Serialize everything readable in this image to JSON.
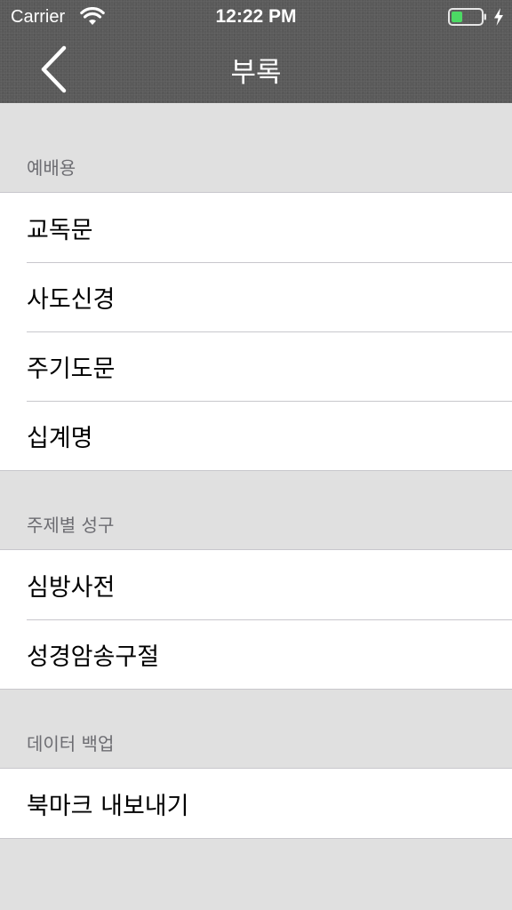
{
  "status_bar": {
    "carrier": "Carrier",
    "time": "12:22 PM",
    "battery_color": "#4cd964"
  },
  "nav": {
    "title": "부록",
    "back_icon": "chevron-left-icon"
  },
  "sections": [
    {
      "header": "예배용",
      "items": [
        "교독문",
        "사도신경",
        "주기도문",
        "십계명"
      ]
    },
    {
      "header": "주제별 성구",
      "items": [
        "심방사전",
        "성경암송구절"
      ]
    },
    {
      "header": "데이터 백업",
      "items": [
        "북마크 내보내기"
      ]
    }
  ]
}
